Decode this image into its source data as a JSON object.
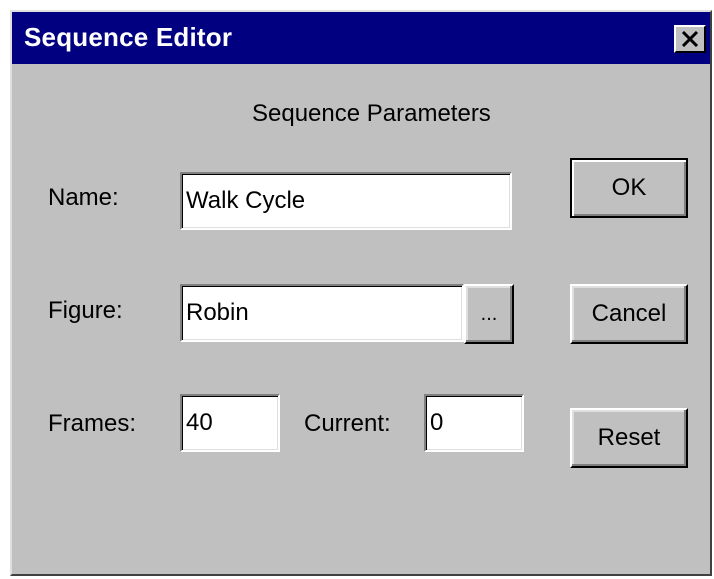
{
  "window": {
    "title": "Sequence Editor",
    "close_icon": "close-icon"
  },
  "group": {
    "title": "Sequence Parameters"
  },
  "fields": {
    "name_label": "Name:",
    "name_value": "Walk Cycle",
    "figure_label": "Figure:",
    "figure_value": "Robin",
    "frames_label": "Frames:",
    "frames_value": "40",
    "current_label": "Current:",
    "current_value": "0"
  },
  "buttons": {
    "ok_label": "OK",
    "cancel_label": "Cancel",
    "reset_label": "Reset",
    "browse_label": "..."
  },
  "colors": {
    "titlebar": "#000080",
    "face": "#c0c0c0",
    "field_bg": "#ffffff"
  }
}
